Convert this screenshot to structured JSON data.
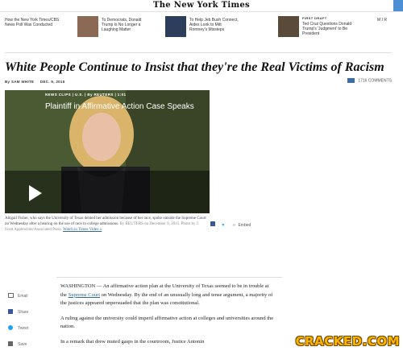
{
  "masthead": {
    "logo": "The New York Times"
  },
  "promos": [
    {
      "kicker": "",
      "text": "How the New York Times/CBS News Poll Was Conducted"
    },
    {
      "kicker": "",
      "text": "To Democrats, Donald Trump Is No Longer a Laughing Matter"
    },
    {
      "kicker": "",
      "text": "To Help Jeb Bush Connect, Aides Look to Mitt Romney's Missteps"
    },
    {
      "kicker": "FIRST DRAFT",
      "text": "Ted Cruz Questions Donald Trump's 'Judgment' to Be President"
    },
    {
      "kicker": "",
      "text": "M I R"
    }
  ],
  "article": {
    "headline": "White People Continue to Insist that they're the Real Victims of Racism",
    "byline": "By SAM WHITE",
    "date": "DEC. 9, 2015",
    "comments": "1716 COMMENTS"
  },
  "video": {
    "kicker_section": "NEWS CLIPS",
    "kicker_sub": "U.S.",
    "kicker_source": "By REUTERS",
    "kicker_duration": "1:01",
    "title": "Plaintiff in Affirmative Action Case Speaks",
    "caption": "Abigail Fisher, who says the University of Texas denied her admission because of her race, spoke outside the Supreme Court on Wednesday after a hearing on the use of race in college admissions.",
    "caption_credit": "By REUTERS on December 9, 2015. Photo by J. Scott Applewhite/Associated Press.",
    "watch_label": "Watch in Times Video »",
    "embed_label": "Embed"
  },
  "tools": {
    "email": "Email",
    "share": "Share",
    "tweet": "Tweet",
    "save": "Save"
  },
  "body": {
    "p1_a": "WASHINGTON — An affirmative action plan at the University of Texas seemed to be in trouble at the ",
    "p1_link": "Supreme Court",
    "p1_b": " on Wednesday. By the end of an unusually long and tense argument, a majority of the justices appeared unpersuaded that the plan was constitutional.",
    "p2": "A ruling against the university could imperil affirmative action at colleges and universities around the nation.",
    "p3": "In a remark that drew muted gasps in the courtroom, Justice Antonin"
  },
  "watermark": "CRACKED.COM",
  "colors": {
    "watermark": "#f6b400",
    "link": "#326891",
    "comments_icon": "#3a6ea5"
  }
}
